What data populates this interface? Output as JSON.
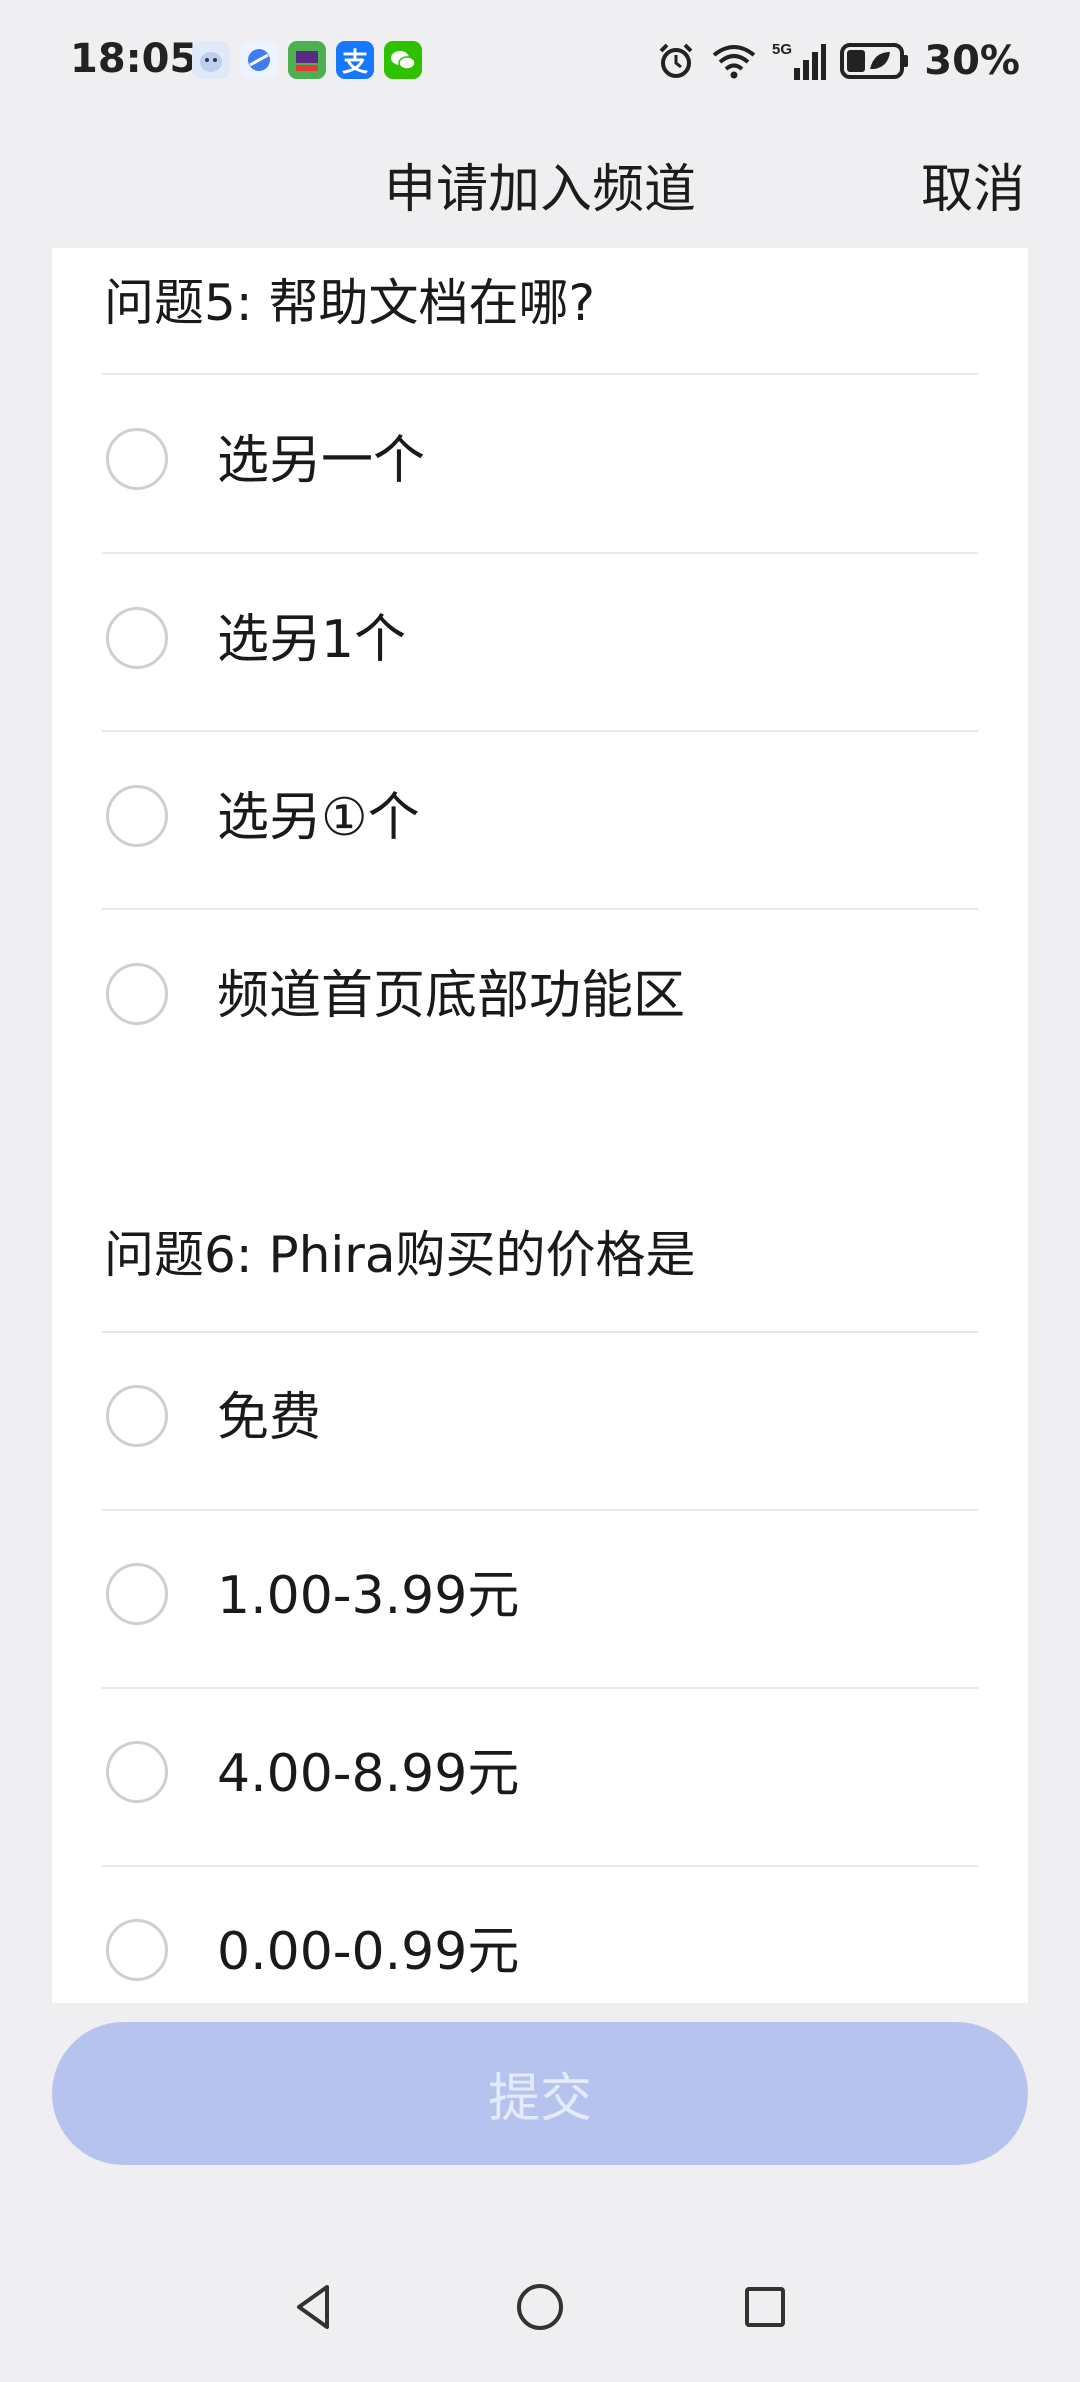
{
  "status": {
    "time": "18:05",
    "battery": "30%",
    "network": "5G"
  },
  "header": {
    "title": "申请加入频道",
    "cancel": "取消"
  },
  "questions": [
    {
      "title": "问题5: 帮助文档在哪?",
      "options": [
        "选另一个",
        "选另1个",
        "选另①个",
        "频道首页底部功能区"
      ]
    },
    {
      "title": "问题6: Phira购买的价格是",
      "options": [
        "免费",
        "1.00-3.99元",
        "4.00-8.99元",
        "0.00-0.99元"
      ]
    }
  ],
  "submit": "提交",
  "colors": {
    "background": "#efeff2",
    "card": "#ffffff",
    "submit_disabled": "#b6c3ee",
    "radio_border": "#cfcfcf"
  },
  "icons": [
    "qq-icon",
    "browser-icon",
    "game-app-icon",
    "alipay-icon",
    "wechat-icon",
    "alarm-icon",
    "wifi-icon",
    "signal-icon",
    "battery-icon",
    "back-icon",
    "home-icon",
    "recents-icon"
  ]
}
